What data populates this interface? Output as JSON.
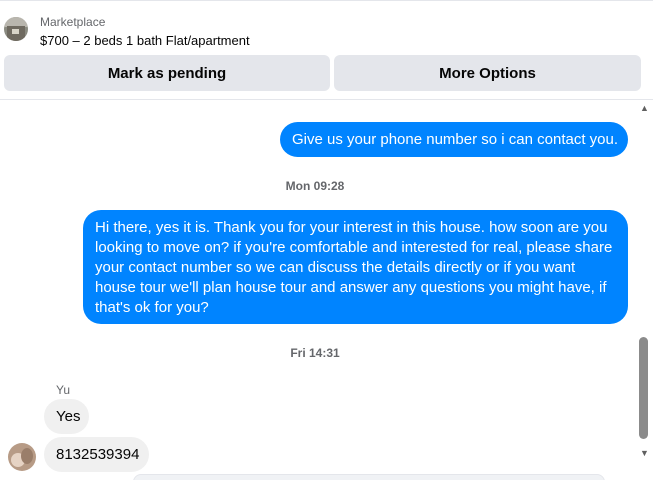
{
  "listing": {
    "label": "Marketplace",
    "title": "$700 – 2 beds 1 bath Flat/apartment"
  },
  "actions": {
    "mark_pending": "Mark as pending",
    "more_options": "More Options"
  },
  "thread": {
    "messages": [
      {
        "direction": "outgoing",
        "text": "Give us your phone number so i can contact you."
      },
      {
        "direction": "outgoing",
        "text": "Hi there, yes it is. Thank you for your interest in this house. how soon are you looking to move on? if you're comfortable and interested for real, please share your contact number so we can discuss the details directly or if you want house tour we'll plan house tour and answer any questions you might have, if that's ok for you?"
      },
      {
        "direction": "incoming",
        "text": "Yes"
      },
      {
        "direction": "incoming",
        "text": "8132539394"
      }
    ],
    "timestamps": [
      "Mon 09:28",
      "Fri 14:31"
    ],
    "sender_name": "Yu"
  },
  "scrollbar": {
    "up_icon": "▲",
    "down_icon": "▼"
  }
}
